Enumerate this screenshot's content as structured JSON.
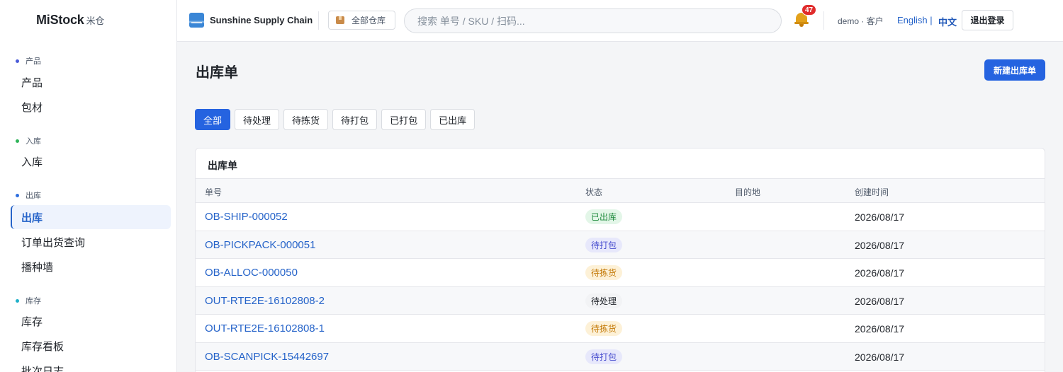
{
  "brand": {
    "name": "MiStock",
    "sub": "米仓"
  },
  "sidebar": {
    "groups": [
      {
        "title": "产品",
        "color": "#4a5bd8",
        "items": [
          {
            "label": "产品"
          },
          {
            "label": "包材"
          }
        ]
      },
      {
        "title": "入库",
        "color": "#2fb45a",
        "items": [
          {
            "label": "入库"
          }
        ]
      },
      {
        "title": "出库",
        "color": "#2f6fdf",
        "items": [
          {
            "label": "出库",
            "active": true
          },
          {
            "label": "订单出货查询"
          },
          {
            "label": "播种墙"
          }
        ]
      },
      {
        "title": "库存",
        "color": "#1fb0c9",
        "items": [
          {
            "label": "库存"
          },
          {
            "label": "库存看板"
          },
          {
            "label": "批次日志"
          }
        ]
      }
    ]
  },
  "header": {
    "tenant": "Sunshine Supply Chain",
    "tenant_icon": "tenant-logo-icon",
    "warehouse": "全部仓库",
    "warehouse_icon": "box-icon",
    "search_placeholder": "搜索 单号 / SKU / 扫码...",
    "notification_count": "47",
    "user": "demo · 客户",
    "lang_en": "English |",
    "lang_zh": "中文",
    "logout": "退出登录"
  },
  "main": {
    "title": "出库单",
    "new_button": "新建出库单",
    "tabs": [
      {
        "label": "全部",
        "active": true
      },
      {
        "label": "待处理"
      },
      {
        "label": "待拣货"
      },
      {
        "label": "待打包"
      },
      {
        "label": "已打包"
      },
      {
        "label": "已出库"
      }
    ],
    "card_title": "出库单",
    "columns": [
      "单号",
      "状态",
      "目的地",
      "创建时间"
    ],
    "rows": [
      {
        "id": "OB-SHIP-000052",
        "status": "已出库",
        "status_type": "shipped",
        "destination": "",
        "created": "2026/08/17"
      },
      {
        "id": "OB-PICKPACK-000051",
        "status": "待打包",
        "status_type": "packing",
        "destination": "",
        "created": "2026/08/17"
      },
      {
        "id": "OB-ALLOC-000050",
        "status": "待拣货",
        "status_type": "picking",
        "destination": "",
        "created": "2026/08/17"
      },
      {
        "id": "OUT-RTE2E-16102808-2",
        "status": "待处理",
        "status_type": "pending",
        "destination": "",
        "created": "2026/08/17"
      },
      {
        "id": "OUT-RTE2E-16102808-1",
        "status": "待拣货",
        "status_type": "picking",
        "destination": "",
        "created": "2026/08/17"
      },
      {
        "id": "OB-SCANPICK-15442697",
        "status": "待打包",
        "status_type": "packing",
        "destination": "",
        "created": "2026/08/17"
      }
    ]
  },
  "colors": {
    "primary": "#2563e0",
    "link": "#2563c9",
    "badge": "#e02c2c"
  }
}
